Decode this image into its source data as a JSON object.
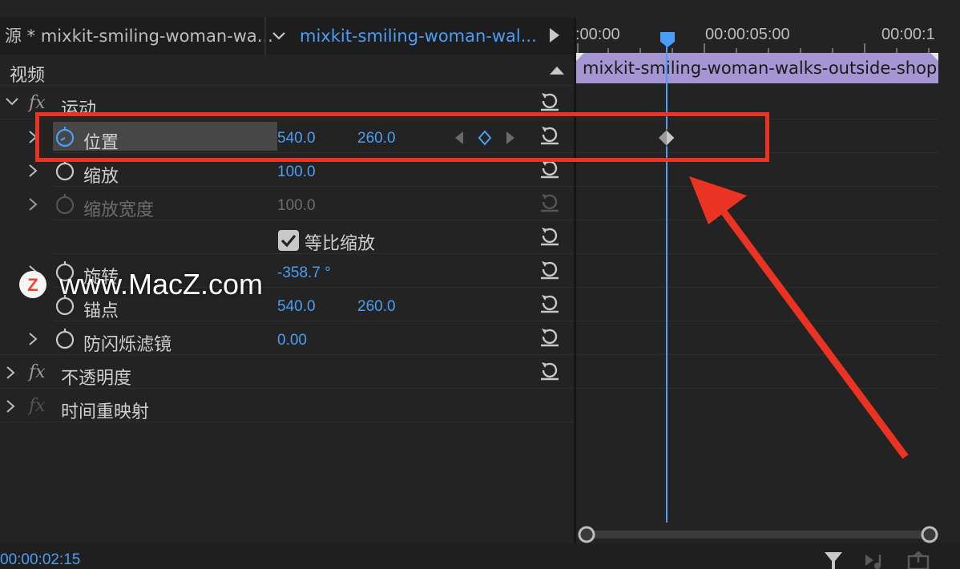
{
  "tabs": {
    "source_label": "源 * mixkit-smiling-woman-wa...",
    "clip_label": "mixkit-smiling-woman-wal..."
  },
  "section": {
    "video_label": "视频"
  },
  "effects": {
    "motion": {
      "label": "运动",
      "position": {
        "label": "位置",
        "x": "540.0",
        "y": "260.0"
      },
      "scale": {
        "label": "缩放",
        "value": "100.0"
      },
      "scale_width": {
        "label": "缩放宽度",
        "value": "100.0"
      },
      "uniform_scale": {
        "label": "等比缩放",
        "checked": true
      },
      "rotation": {
        "label": "旋转",
        "value": "-358.7 °"
      },
      "anchor": {
        "label": "锚点",
        "x": "540.0",
        "y": "260.0"
      },
      "anti_flicker": {
        "label": "防闪烁滤镜",
        "value": "0.00"
      }
    },
    "opacity": {
      "label": "不透明度"
    },
    "time_remap": {
      "label": "时间重映射"
    }
  },
  "timeline": {
    "tick_start": ":00:00",
    "tick_mid": "00:00:05:00",
    "tick_end": "00:00:1",
    "clip_name": "mixkit-smiling-woman-walks-outside-shoppin"
  },
  "current_timecode": "00:00:02:15",
  "watermark": {
    "text": "www.MacZ.com",
    "logo_letter": "Z"
  },
  "colors": {
    "accent": "#4a9ef5",
    "clip": "#a595d3",
    "annotation": "#ea3323",
    "background": "#232323"
  },
  "icons": [
    "stopwatch-icon",
    "reset-icon",
    "keyframe-diamond-icon",
    "chevron-right-icon",
    "chevron-down-icon",
    "play-icon",
    "filter-icon",
    "export-icon"
  ]
}
